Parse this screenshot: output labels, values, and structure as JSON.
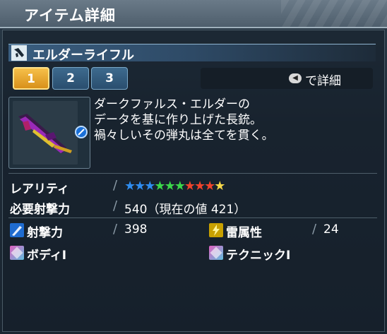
{
  "window": {
    "title": "アイテム詳細"
  },
  "item": {
    "name": "エルダーライフル"
  },
  "tabs": [
    {
      "label": "1",
      "active": true
    },
    {
      "label": "2",
      "active": false
    },
    {
      "label": "3",
      "active": false
    }
  ],
  "detail_button": {
    "key_icon": "key-icon",
    "label": "で詳細"
  },
  "description": [
    "ダークファルス・エルダーの",
    "データを基に作り上げた長銃。",
    "禍々しいその弾丸は全てを貫く。"
  ],
  "stats": {
    "rarity": {
      "label": "レアリティ",
      "value": 10,
      "max": 10
    },
    "requirement": {
      "label": "必要射撃力",
      "value": "540（現在の値 421）"
    },
    "attack": {
      "label": "射撃力",
      "value": "398",
      "icon": "ranged-attack-icon"
    },
    "element": {
      "label": "雷属性",
      "value": "24",
      "icon": "lightning-element-icon"
    },
    "ability1": {
      "label": "ボディI",
      "icon": "ability-icon"
    },
    "ability2": {
      "label": "テクニックI",
      "icon": "ability-icon"
    }
  },
  "colors": {
    "star_blue": "#2f8df0",
    "star_green": "#3cd84a",
    "star_red": "#f0442c",
    "star_gold": "#f6d84a",
    "tab_active": "#f0b030",
    "tab_inactive": "#3d6a8e"
  }
}
